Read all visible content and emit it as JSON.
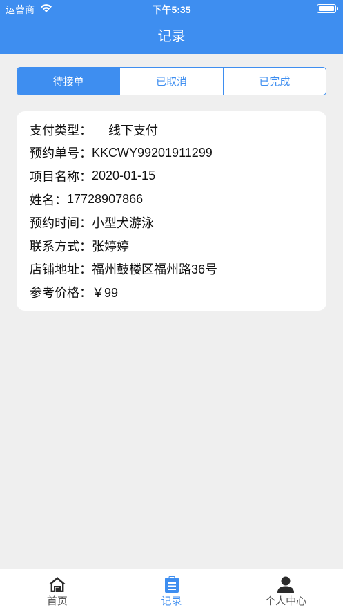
{
  "status_bar": {
    "carrier": "运营商",
    "time": "下午5:35"
  },
  "header": {
    "title": "记录"
  },
  "tabs": [
    {
      "label": "待接单",
      "active": true
    },
    {
      "label": "已取消",
      "active": false
    },
    {
      "label": "已完成",
      "active": false
    }
  ],
  "record": {
    "payment_type_label": "支付类型：",
    "payment_type_value": "线下支付",
    "order_no_label": "预约单号：",
    "order_no_value": "KKCWY99201911299",
    "project_name_label": "项目名称：",
    "project_name_value": "2020-01-15",
    "name_label": "姓名：",
    "name_value": "17728907866",
    "appointment_time_label": "预约时间：",
    "appointment_time_value": "小型犬游泳",
    "contact_label": "联系方式：",
    "contact_value": "张婷婷",
    "address_label": "店铺地址：",
    "address_value": "福州鼓楼区福州路36号",
    "price_label": "参考价格：",
    "price_value": "￥99"
  },
  "bottom_nav": [
    {
      "label": "首页",
      "icon": "home-icon",
      "active": false
    },
    {
      "label": "记录",
      "icon": "clipboard-icon",
      "active": true
    },
    {
      "label": "个人中心",
      "icon": "person-icon",
      "active": false
    }
  ],
  "colors": {
    "primary": "#3e8ef0",
    "background": "#efefef",
    "card": "#ffffff"
  }
}
